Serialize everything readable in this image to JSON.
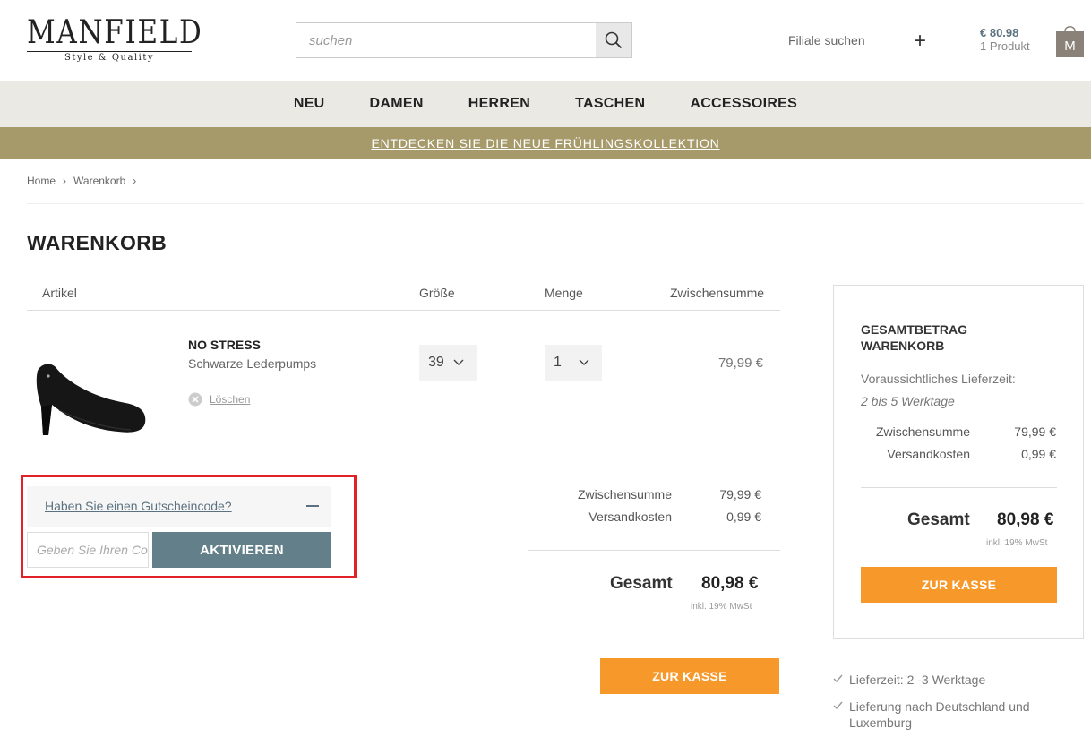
{
  "header": {
    "logo_text": "MANFIELD",
    "logo_tagline": "Style & Quality",
    "search_placeholder": "suchen",
    "store_label": "Filiale suchen",
    "store_icon": "plus-icon",
    "cart_price": "€ 80.98",
    "cart_count": "1 Produkt",
    "cart_bag_letter": "M"
  },
  "nav": {
    "items": [
      "NEU",
      "DAMEN",
      "HERREN",
      "TASCHEN",
      "ACCESSOIRES"
    ]
  },
  "banner": {
    "text": "ENTDECKEN SIE DIE NEUE FRÜHLINGSKOLLEKTION"
  },
  "breadcrumb": {
    "items": [
      "Home",
      "Warenkorb"
    ],
    "separator": "›"
  },
  "page": {
    "title": "WARENKORB"
  },
  "table": {
    "headers": {
      "article": "Artikel",
      "size": "Größe",
      "quantity": "Menge",
      "subtotal": "Zwischensumme"
    }
  },
  "item": {
    "name": "NO STRESS",
    "description": "Schwarze Lederpumps",
    "delete_label": "Löschen",
    "size": "39",
    "quantity": "1",
    "subtotal": "79,99 €"
  },
  "coupon": {
    "link_label": "Haben Sie einen Gutscheincode?",
    "input_placeholder": "Geben Sie Ihren Code ein",
    "button_label": "AKTIVIEREN"
  },
  "totals": {
    "subtotal_label": "Zwischensumme",
    "subtotal_value": "79,99 €",
    "shipping_label": "Versandkosten",
    "shipping_value": "0,99 €",
    "total_label": "Gesamt",
    "total_value": "80,98 €",
    "vat_note": "inkl. 19% MwSt",
    "checkout_label": "ZUR KASSE"
  },
  "summary": {
    "title_line1": "GESAMTBETRAG",
    "title_line2": "WARENKORB",
    "delivery_label": "Voraussichtliches Lieferzeit:",
    "delivery_value": "2 bis 5 Werktage",
    "subtotal_label": "Zwischensumme",
    "subtotal_value": "79,99 €",
    "shipping_label": "Versandkosten",
    "shipping_value": "0,99 €",
    "total_label": "Gesamt",
    "total_value": "80,98 €",
    "vat_note": "inkl. 19% MwSt",
    "checkout_label": "ZUR KASSE"
  },
  "usps": [
    "Lieferzeit: 2 -3 Werktage",
    "Lieferung nach Deutschland und Luxemburg"
  ],
  "colors": {
    "nav_bg": "#ebe9e4",
    "banner_bg": "#a69a6b",
    "checkout_orange": "#f7982b",
    "activate_slate": "#63808a",
    "highlight_red": "#e02128",
    "cart_price_blue": "#5b7180"
  }
}
